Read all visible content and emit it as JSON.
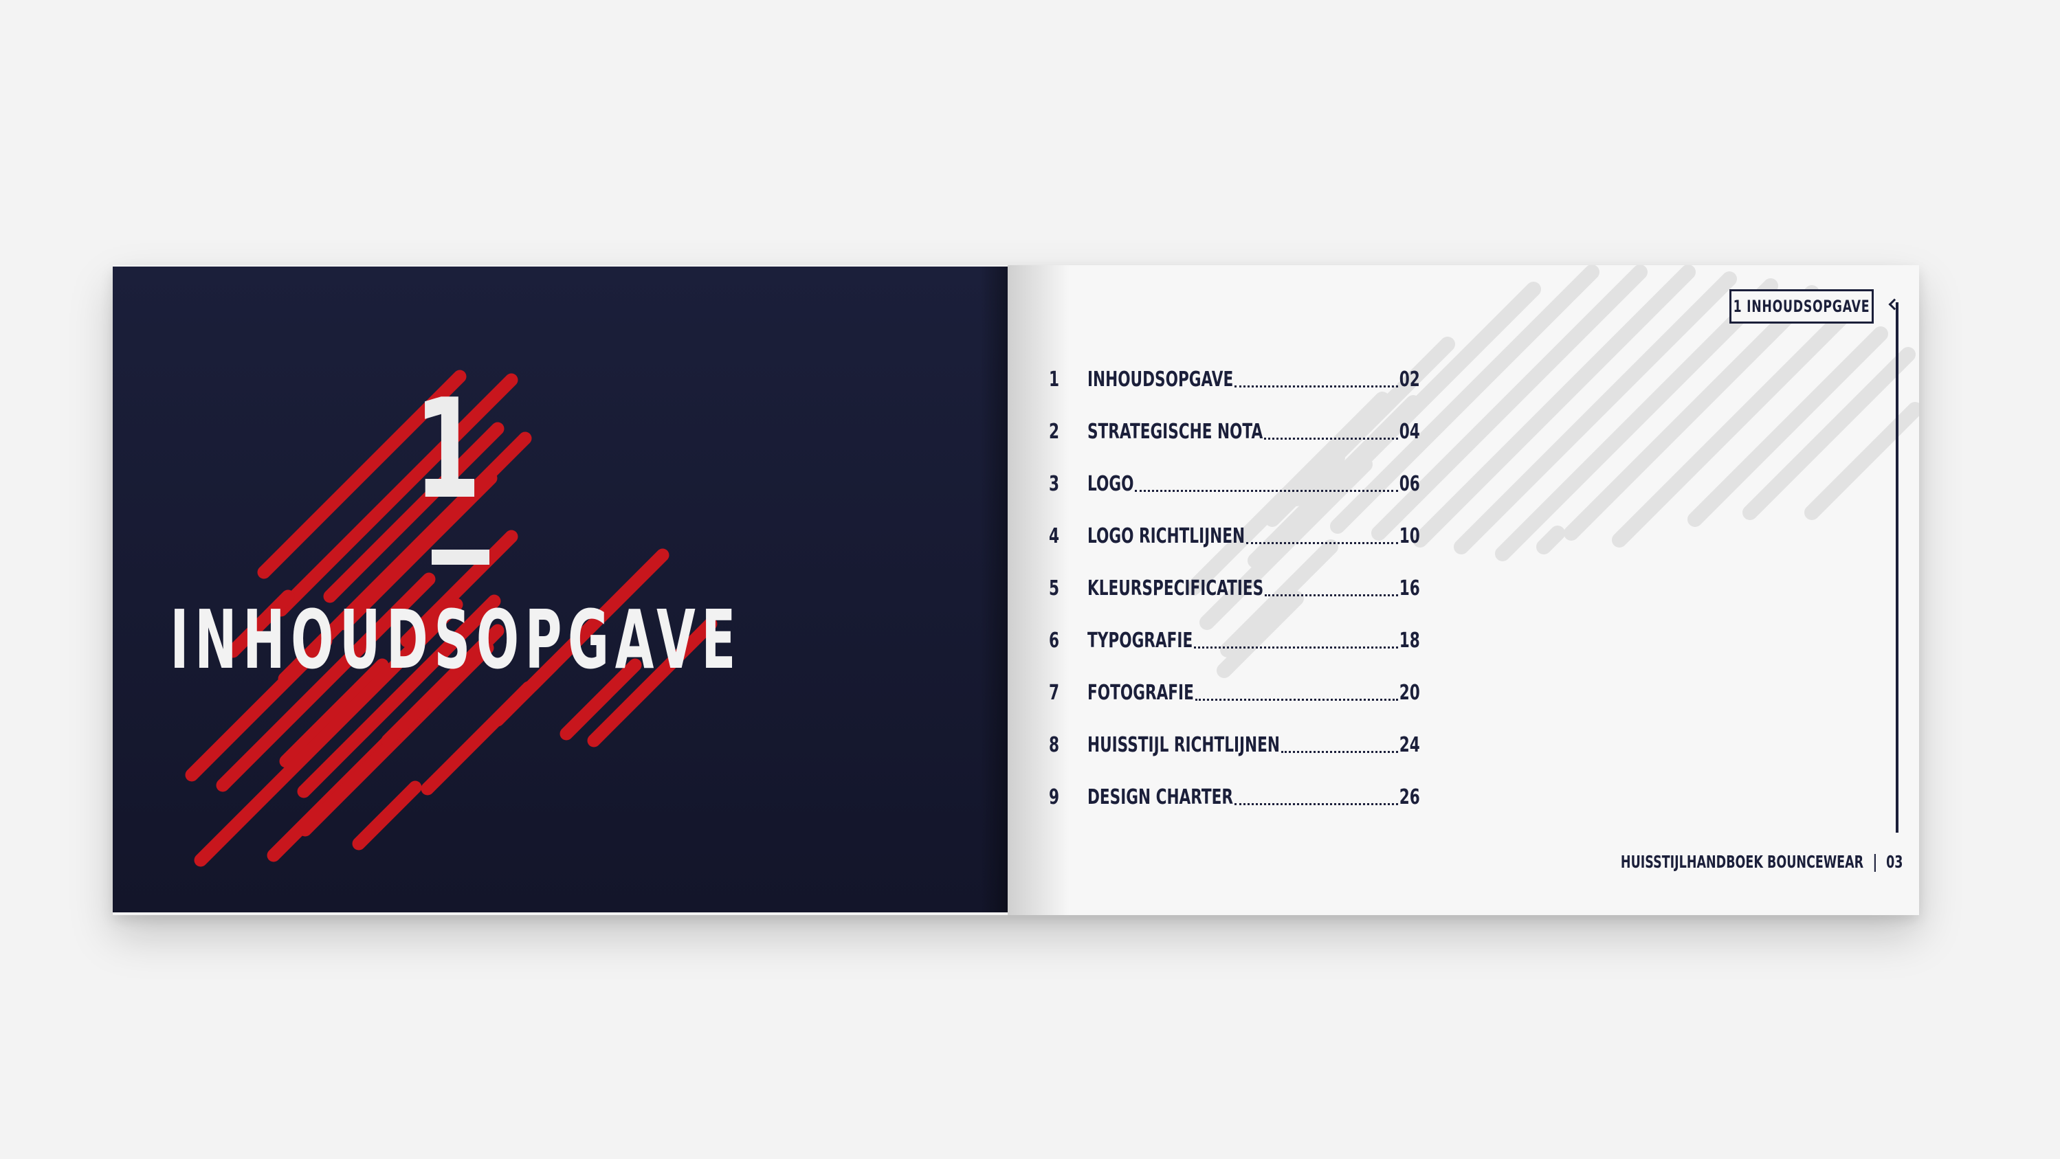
{
  "cover": {
    "chapter_number": "1",
    "title": "INHOUDSOPGAVE"
  },
  "header": {
    "badge_label": "1  INHOUDSOPGAVE"
  },
  "toc": [
    {
      "num": "1",
      "label": "INHOUDSOPGAVE",
      "page": "02"
    },
    {
      "num": "2",
      "label": "STRATEGISCHE NOTA",
      "page": "04"
    },
    {
      "num": "3",
      "label": "LOGO",
      "page": "06"
    },
    {
      "num": "4",
      "label": "LOGO RICHTLIJNEN",
      "page": "10"
    },
    {
      "num": "5",
      "label": "KLEURSPECIFICATIES",
      "page": "16"
    },
    {
      "num": "6",
      "label": "TYPOGRAFIE",
      "page": "18"
    },
    {
      "num": "7",
      "label": "FOTOGRAFIE",
      "page": "20"
    },
    {
      "num": "8",
      "label": "HUISSTIJL RICHTLIJNEN",
      "page": "24"
    },
    {
      "num": "9",
      "label": "DESIGN CHARTER",
      "page": "26"
    }
  ],
  "footer": {
    "document_title": "HUISSTIJLHANDBOEK BOUNCEWEAR",
    "page_number": "03"
  },
  "colors": {
    "navy": "#1b1f3a",
    "accent_red": "#c8161d",
    "stripe_grey": "#e2e2e2",
    "paper": "#f7f7f7"
  }
}
